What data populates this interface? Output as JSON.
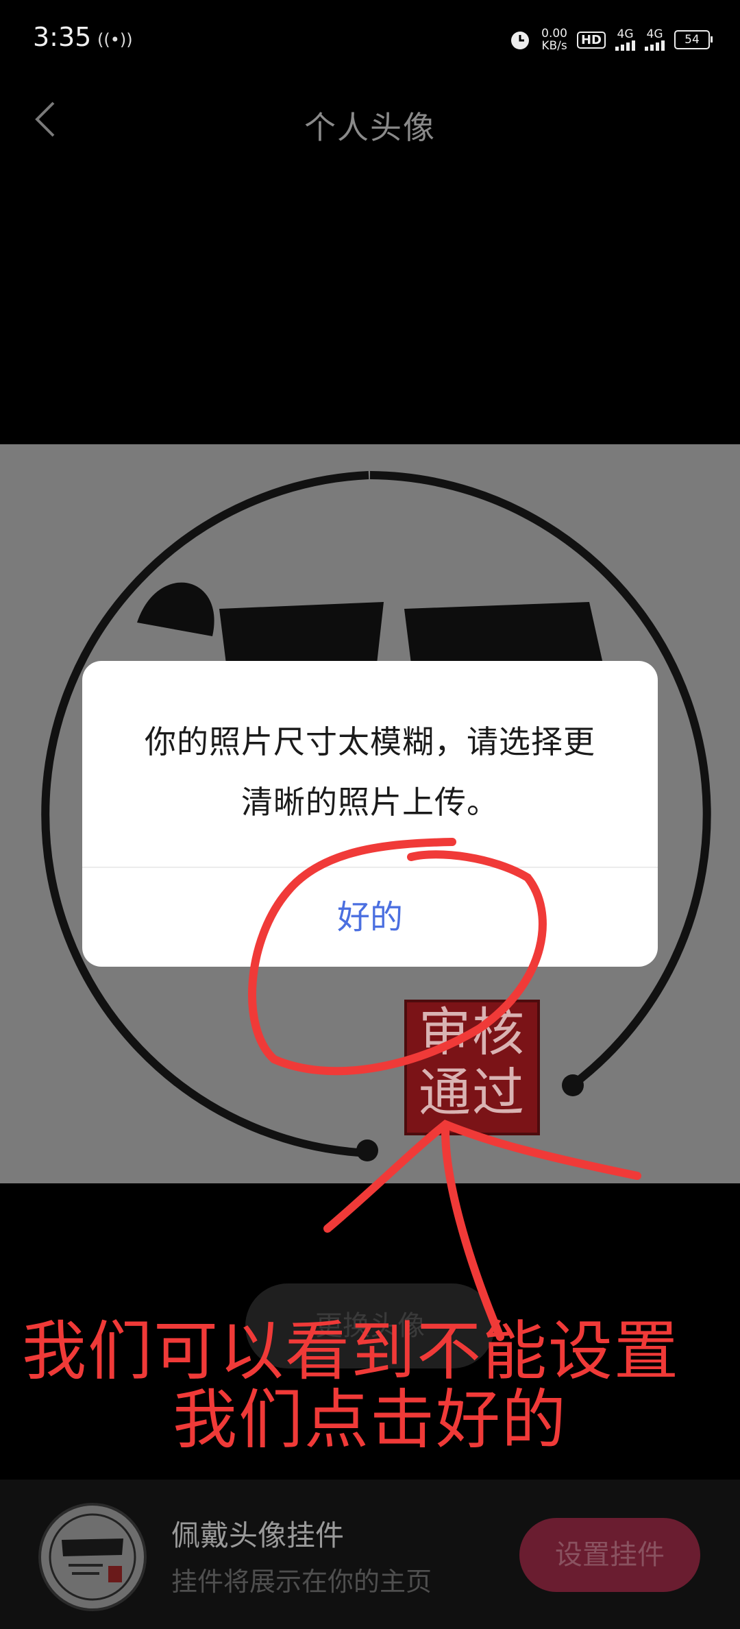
{
  "status_bar": {
    "time": "3:35",
    "hotspot_icon": "((•))",
    "net_speed_value": "0.00",
    "net_speed_unit": "KB/s",
    "hd_badge": "HD",
    "sim1_label": "4G",
    "sim2_label": "4G",
    "battery_level": "54"
  },
  "nav": {
    "title": "个人头像",
    "back_icon": "chevron-left-icon"
  },
  "dialog": {
    "message": "你的照片尺寸太模糊，请选择更清晰的照片上传。",
    "ok_label": "好的"
  },
  "avatar_seal": {
    "line1": "审核",
    "line2": "通过"
  },
  "change_avatar_button": "更换头像",
  "annotation": {
    "line1": "我们可以看到不能设置",
    "line2": "我们点击好的",
    "color": "#f03a38"
  },
  "pendant": {
    "title": "佩戴头像挂件",
    "subtitle": "挂件将展示在你的主页",
    "set_button": "设置挂件"
  }
}
